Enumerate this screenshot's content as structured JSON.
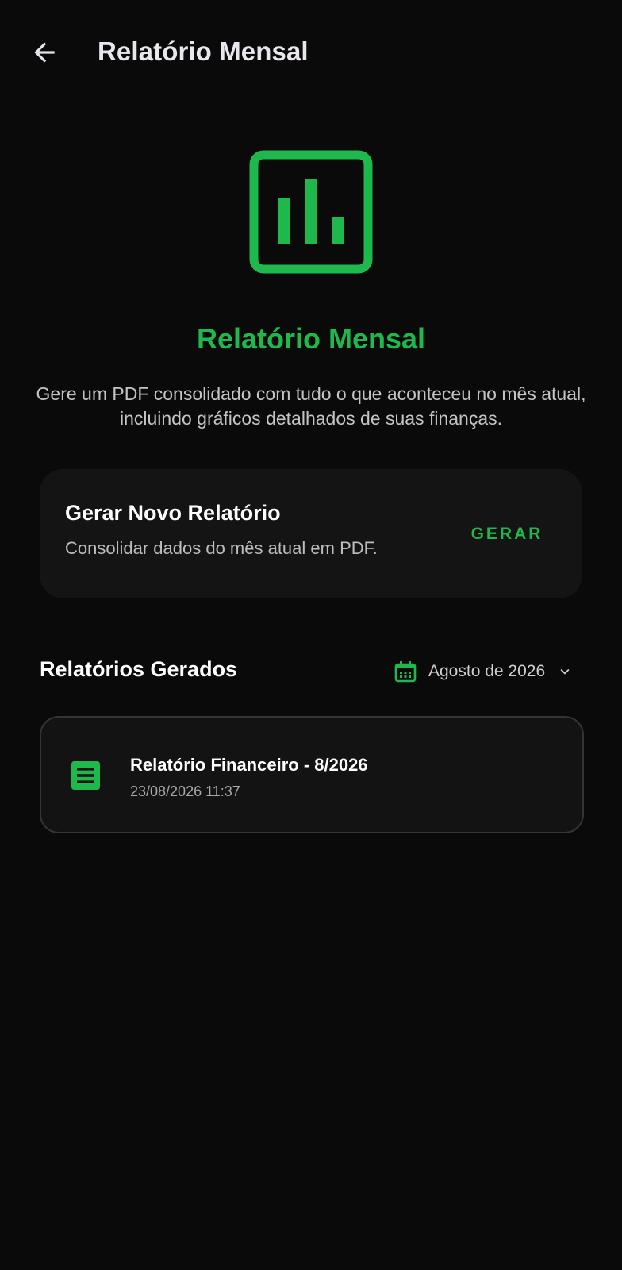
{
  "app_bar": {
    "title": "Relatório Mensal",
    "back_icon": "arrow-back-icon"
  },
  "hero": {
    "icon": "bar-chart-box-icon",
    "title": "Relatório Mensal",
    "description": "Gere um PDF consolidado com tudo o que aconteceu no mês atual, incluindo gráficos detalhados de suas finanças."
  },
  "generate_card": {
    "title": "Gerar Novo Relatório",
    "subtitle": "Consolidar dados do mês atual em PDF.",
    "button_label": "GERAR"
  },
  "reports_section": {
    "title": "Relatórios Gerados",
    "month_filter": {
      "icon": "calendar-icon",
      "selected": "Agosto de 2026",
      "chevron_icon": "chevron-down-icon"
    },
    "items": [
      {
        "icon": "document-icon",
        "title": "Relatório Financeiro - 8/2026",
        "date": "23/08/2026 11:37"
      }
    ]
  },
  "colors": {
    "background": "#0a0a0a",
    "accent": "#1fb84d",
    "card": "#141414",
    "card_border": "#343434",
    "title_text": "#e9e6ee",
    "muted_text": "#c4c4c4"
  }
}
